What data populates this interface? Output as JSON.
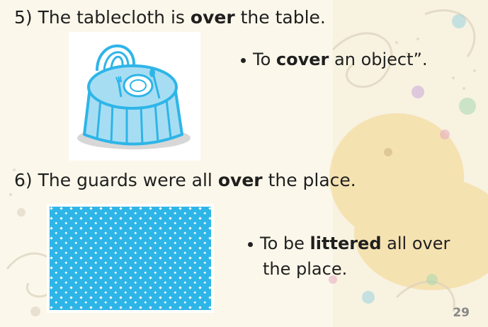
{
  "slide": {
    "item5": {
      "number": "5)",
      "prefix": "The tablecloth is",
      "keyword": "over",
      "suffix": "the table."
    },
    "bullet1": {
      "prefix": "To",
      "keyword": "cover",
      "suffix": "an object”."
    },
    "item6": {
      "number": "6)",
      "prefix": "The guards were all",
      "keyword": "over",
      "suffix": "the place."
    },
    "bullet2": {
      "prefix": "To be",
      "keyword": "littered",
      "line1_suffix": "all over",
      "line2": "the place."
    },
    "page_number": "29"
  },
  "colors": {
    "accent_blue": "#2eb5e8",
    "light_blue": "#a7ddf3",
    "text": "#1f1f1f"
  },
  "icons": [
    "tablecloth-illustration",
    "polka-dot-pattern",
    "bullet-icon"
  ]
}
